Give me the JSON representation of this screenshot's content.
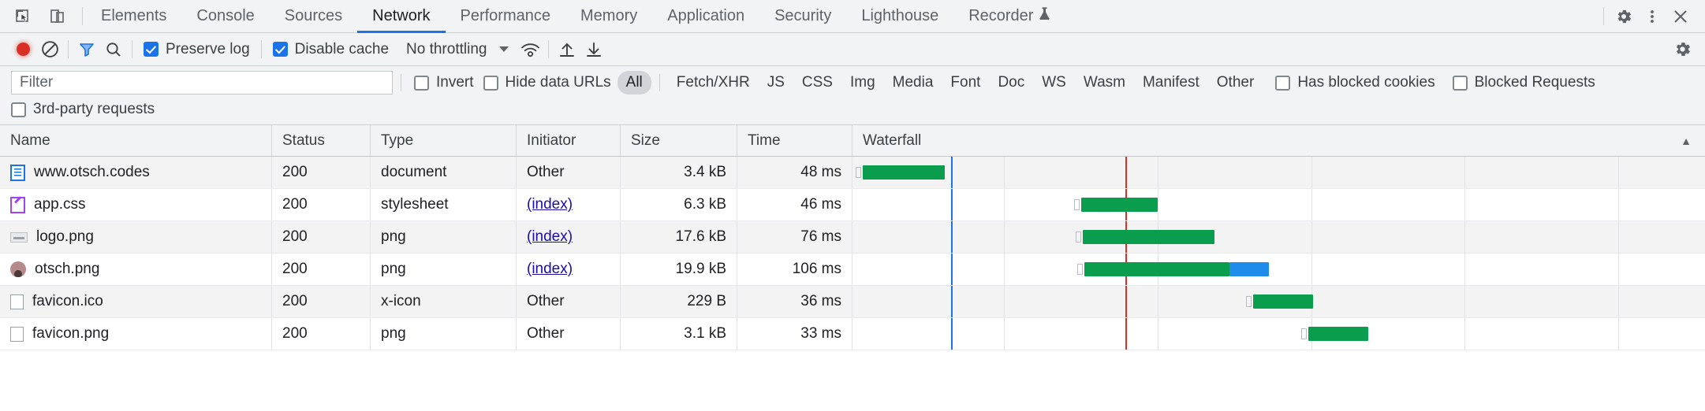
{
  "tabbar": {
    "left_icons": [
      {
        "name": "inspect-element-icon",
        "title": "Inspect"
      },
      {
        "name": "device-toolbar-icon",
        "title": "Toggle device toolbar"
      }
    ],
    "tabs": [
      {
        "label": "Elements",
        "active": false
      },
      {
        "label": "Console",
        "active": false
      },
      {
        "label": "Sources",
        "active": false
      },
      {
        "label": "Network",
        "active": true
      },
      {
        "label": "Performance",
        "active": false
      },
      {
        "label": "Memory",
        "active": false
      },
      {
        "label": "Application",
        "active": false
      },
      {
        "label": "Security",
        "active": false
      },
      {
        "label": "Lighthouse",
        "active": false
      },
      {
        "label": "Recorder",
        "active": false,
        "badge": "experiment-flask-icon"
      }
    ],
    "right_icons": [
      {
        "name": "settings-gear-icon"
      },
      {
        "name": "more-options-kebab-icon"
      },
      {
        "name": "close-devtools-icon"
      }
    ],
    "accent_color": "#1a73e8"
  },
  "toolbar": {
    "record_button": {
      "name": "record-network-log-button",
      "state": "recording",
      "color": "#d93025"
    },
    "clear_button": {
      "name": "clear-button"
    },
    "filter_button": {
      "name": "filter-funnel-icon",
      "active": true,
      "color": "#1a73e8"
    },
    "search_button": {
      "name": "search-icon"
    },
    "preserve_log": {
      "label": "Preserve log",
      "checked": true
    },
    "disable_cache": {
      "label": "Disable cache",
      "checked": true
    },
    "throttling": {
      "value": "No throttling"
    },
    "network_conditions_icon": "wifi-icon",
    "upload_icon": "import-har-icon",
    "download_icon": "export-har-icon",
    "settings_icon": "network-settings-gear-icon"
  },
  "filterbar": {
    "filter_placeholder": "Filter",
    "invert": {
      "label": "Invert",
      "checked": false
    },
    "hide_data_urls": {
      "label": "Hide data URLs",
      "checked": false
    },
    "types": [
      {
        "label": "All",
        "selected": true
      },
      {
        "label": "Fetch/XHR",
        "selected": false
      },
      {
        "label": "JS",
        "selected": false
      },
      {
        "label": "CSS",
        "selected": false
      },
      {
        "label": "Img",
        "selected": false
      },
      {
        "label": "Media",
        "selected": false
      },
      {
        "label": "Font",
        "selected": false
      },
      {
        "label": "Doc",
        "selected": false
      },
      {
        "label": "WS",
        "selected": false
      },
      {
        "label": "Wasm",
        "selected": false
      },
      {
        "label": "Manifest",
        "selected": false
      },
      {
        "label": "Other",
        "selected": false
      }
    ],
    "has_blocked_cookies": {
      "label": "Has blocked cookies",
      "checked": false
    },
    "blocked_requests": {
      "label": "Blocked Requests",
      "checked": false
    },
    "third_party_requests": {
      "label": "3rd-party requests",
      "checked": false
    }
  },
  "table": {
    "columns": [
      {
        "label": "Name"
      },
      {
        "label": "Status"
      },
      {
        "label": "Type"
      },
      {
        "label": "Initiator"
      },
      {
        "label": "Size"
      },
      {
        "label": "Time"
      },
      {
        "label": "Waterfall",
        "sort_indicator": "▲"
      }
    ],
    "rows": [
      {
        "name": "www.otsch.codes",
        "icon": "document-icon",
        "status": "200",
        "type": "document",
        "initiator": "Other",
        "initiator_link": false,
        "size": "3.4 kB",
        "time": "48 ms",
        "wf": {
          "start": 1.2,
          "wait": 0.0,
          "dl": 9.6,
          "blue": 0.0,
          "conn": true
        }
      },
      {
        "name": "app.css",
        "icon": "stylesheet-icon",
        "status": "200",
        "type": "stylesheet",
        "initiator": "(index)",
        "initiator_link": true,
        "size": "6.3 kB",
        "time": "46 ms",
        "wf": {
          "start": 26.8,
          "wait": 0.0,
          "dl": 9.0,
          "blue": 0.0,
          "conn": true
        }
      },
      {
        "name": "logo.png",
        "icon": "image-preview-icon",
        "status": "200",
        "type": "png",
        "initiator": "(index)",
        "initiator_link": true,
        "size": "17.6 kB",
        "time": "76 ms",
        "wf": {
          "start": 27.0,
          "wait": 0.0,
          "dl": 15.5,
          "blue": 0.0,
          "conn": true
        }
      },
      {
        "name": "otsch.png",
        "icon": "avatar-preview-icon",
        "status": "200",
        "type": "png",
        "initiator": "(index)",
        "initiator_link": true,
        "size": "19.9 kB",
        "time": "106 ms",
        "wf": {
          "start": 27.2,
          "wait": 0.0,
          "dl": 17.0,
          "blue": 4.6,
          "conn": true
        }
      },
      {
        "name": "favicon.ico",
        "icon": "blank-file-icon",
        "status": "200",
        "type": "x-icon",
        "initiator": "Other",
        "initiator_link": false,
        "size": "229 B",
        "time": "36 ms",
        "wf": {
          "start": 47.0,
          "wait": 0.0,
          "dl": 7.0,
          "blue": 0.0,
          "conn": true
        }
      },
      {
        "name": "favicon.png",
        "icon": "blank-file-icon",
        "status": "200",
        "type": "png",
        "initiator": "Other",
        "initiator_link": false,
        "size": "3.1 kB",
        "time": "33 ms",
        "wf": {
          "start": 53.5,
          "wait": 0.0,
          "dl": 7.0,
          "blue": 0.0,
          "conn": true
        }
      }
    ],
    "waterfall_markers": [
      {
        "name": "dom-content-loaded-marker",
        "color": "#1a73e8",
        "pos": 11.6
      },
      {
        "name": "load-event-marker",
        "color": "#d93025",
        "pos": 32.0
      }
    ],
    "waterfall_gridlines": [
      17.8,
      35.8,
      53.8,
      71.8,
      89.8
    ]
  }
}
